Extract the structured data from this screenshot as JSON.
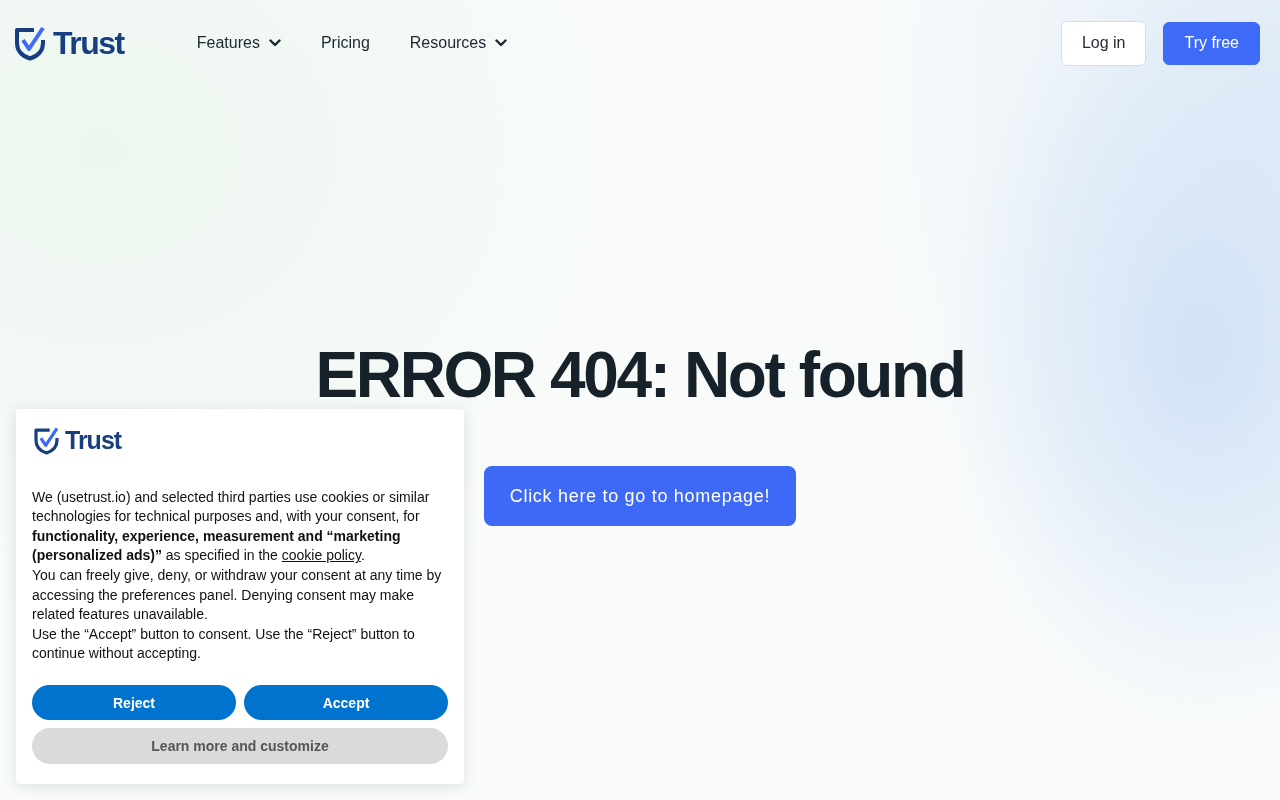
{
  "nav": {
    "logo": {
      "text": "Trust"
    },
    "links": [
      {
        "label": "Features",
        "dropdown": true
      },
      {
        "label": "Pricing",
        "dropdown": false
      },
      {
        "label": "Resources",
        "dropdown": true
      }
    ],
    "buttons": [
      {
        "label": "Log in",
        "kind": "outline"
      },
      {
        "label": "Try free",
        "kind": "primary"
      }
    ]
  },
  "hero": {
    "title": "ERROR 404: Not found",
    "button": "Click here to go to homepage!"
  },
  "cookie_banner": {
    "logo": {
      "text": "Trust"
    },
    "paragraphs": [
      {
        "text": "We (usetrust.io) and selected third parties use cookies or similar technologies for technical purposes and, with your consent, for **functionality, experience, measurement and “marketing (personalized ads)”** as specified in the",
        "link": "cookie policy",
        "after": "."
      },
      {
        "text": "You can freely give, deny, or withdraw your consent at any time by accessing the preferences panel. Denying consent may make related features unavailable."
      },
      {
        "text": "Use the “Accept” button to consent. Use the “Reject” button to continue without accepting."
      }
    ],
    "buttons": [
      {
        "label": "Reject",
        "kind": "primary"
      },
      {
        "label": "Accept",
        "kind": "primary"
      },
      {
        "label": "Learn more and customize",
        "kind": "secondary"
      }
    ]
  }
}
